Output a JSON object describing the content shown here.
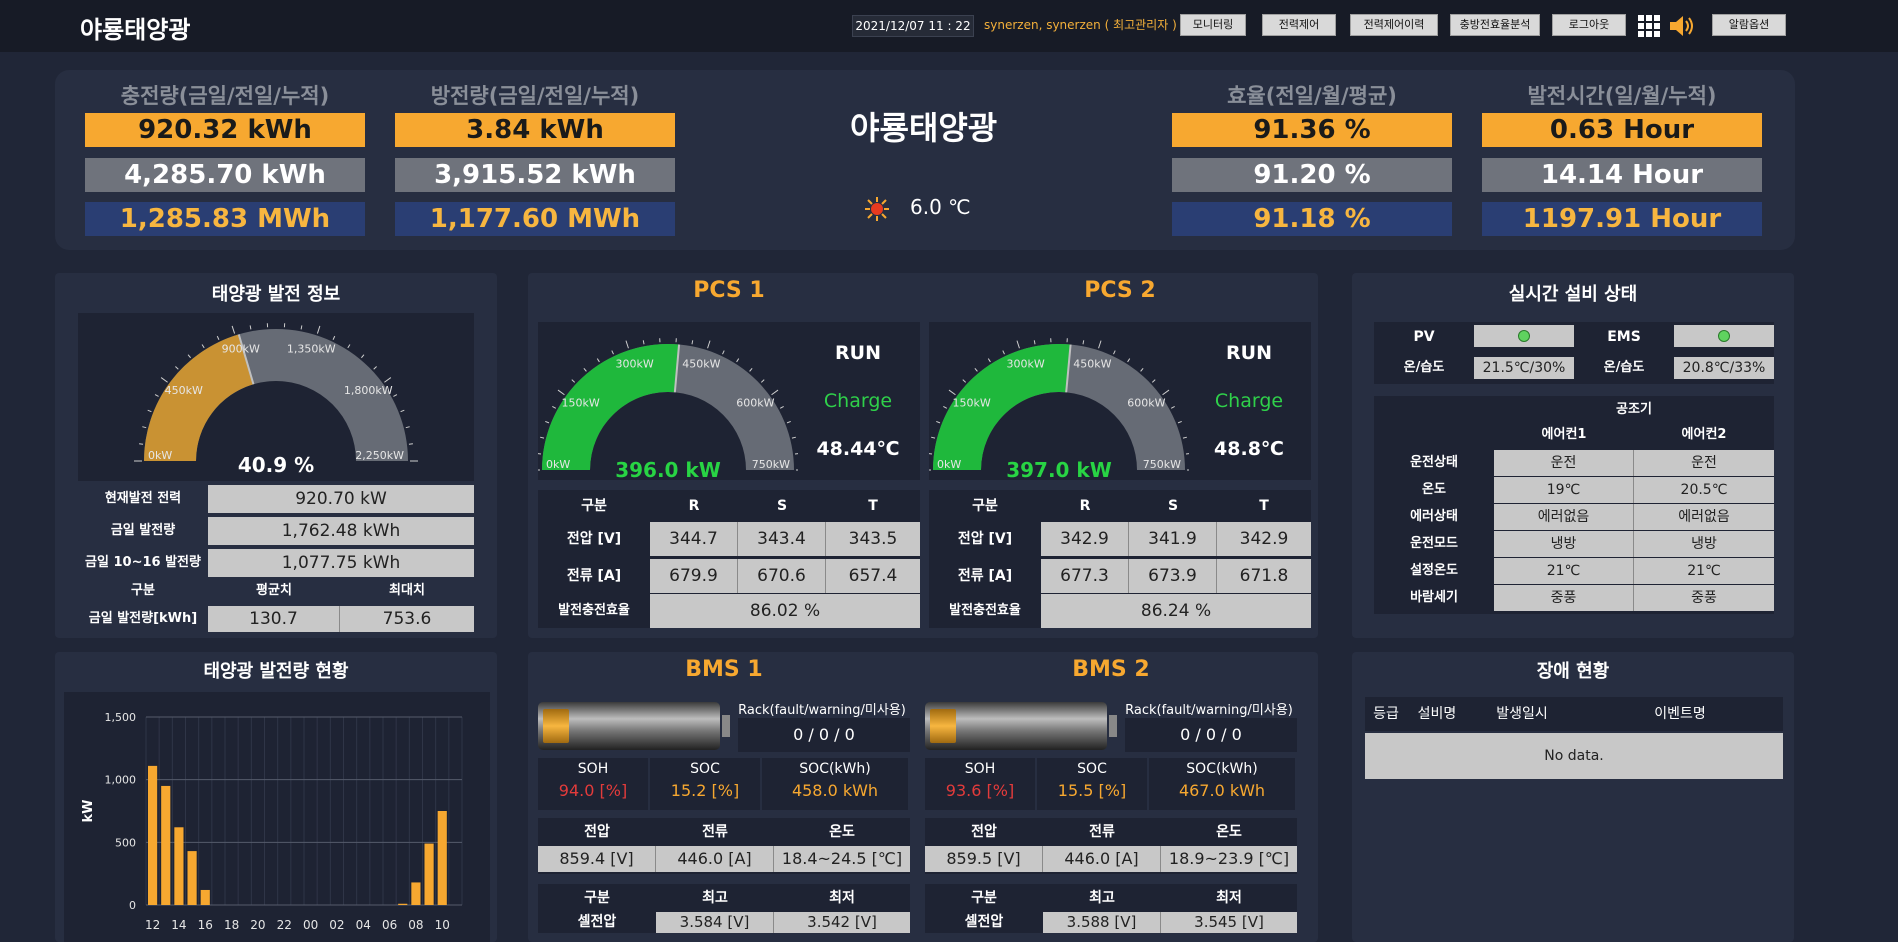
{
  "app": {
    "title": "야룡태양광",
    "datetime": "2021/12/07 11 : 22",
    "user": "synerzen, synerzen ( 최고관리자 )"
  },
  "nav": [
    "모니터링",
    "전력제어",
    "전력제어이력",
    "충방전효율분석",
    "로그아웃",
    "알람옵션"
  ],
  "summary": {
    "title": "야룡태양광",
    "temp": "6.0 ℃",
    "charge": {
      "label": "충전량(금일/전일/누적)",
      "v1": "920.32 kWh",
      "v2": "4,285.70 kWh",
      "v3": "1,285.83 MWh"
    },
    "discharge": {
      "label": "방전량(금일/전일/누적)",
      "v1": "3.84 kWh",
      "v2": "3,915.52 kWh",
      "v3": "1,177.60 MWh"
    },
    "efficiency": {
      "label": "효율(전일/월/평균)",
      "v1": "91.36 %",
      "v2": "91.20 %",
      "v3": "91.18 %"
    },
    "gentime": {
      "label": "발전시간(일/월/누적)",
      "v1": "0.63 Hour",
      "v2": "14.14 Hour",
      "v3": "1197.91 Hour"
    }
  },
  "solar": {
    "title": "태양광 발전 정보",
    "gauge": {
      "percent": "40.9 %",
      "value": 40.9,
      "ticks": [
        "0kW",
        "450kW",
        "900kW",
        "1,350kW",
        "1,800kW",
        "2,250kW"
      ]
    },
    "rows": [
      {
        "label": "현재발전 전력",
        "value": "920.70  kW"
      },
      {
        "label": "금일 발전량",
        "value": "1,762.48  kWh"
      },
      {
        "label": "금일 10~16 발전량",
        "value": "1,077.75  kWh"
      }
    ],
    "table": {
      "h0": "구분",
      "h1": "평균치",
      "h2": "최대치",
      "r0": "금일 발전량[kWh]",
      "r1": "130.7",
      "r2": "753.6"
    }
  },
  "pcs": [
    {
      "title": "PCS 1",
      "gauge_value": "396.0 kW",
      "value": 396.0,
      "ticks": [
        "0kW",
        "150kW",
        "300kW",
        "450kW",
        "600kW",
        "750kW"
      ],
      "status": "RUN",
      "mode": "Charge",
      "temp": "48.44℃",
      "heads": [
        "구분",
        "R",
        "S",
        "T"
      ],
      "volt_label": "전압 [V]",
      "volt": [
        "344.7",
        "343.4",
        "343.5"
      ],
      "curr_label": "전류 [A]",
      "curr": [
        "679.9",
        "670.6",
        "657.4"
      ],
      "eff_label": "발전충전효율",
      "eff": "86.02 %"
    },
    {
      "title": "PCS 2",
      "gauge_value": "397.0 kW",
      "value": 397.0,
      "ticks": [
        "0kW",
        "150kW",
        "300kW",
        "450kW",
        "600kW",
        "750kW"
      ],
      "status": "RUN",
      "mode": "Charge",
      "temp": "48.8℃",
      "heads": [
        "구분",
        "R",
        "S",
        "T"
      ],
      "volt_label": "전압 [V]",
      "volt": [
        "342.9",
        "341.9",
        "342.9"
      ],
      "curr_label": "전류 [A]",
      "curr": [
        "677.3",
        "673.9",
        "671.8"
      ],
      "eff_label": "발전충전효율",
      "eff": "86.24 %"
    }
  ],
  "realtime": {
    "title": "실시간 설비 상태",
    "pv_label": "PV",
    "ems_label": "EMS",
    "hum_label": "온/습도",
    "pv_hum": "21.5℃/30%",
    "ems_hum": "20.8℃/33%",
    "ac_title": "공조기",
    "ac1": "에어컨1",
    "ac2": "에어컨2",
    "rows": [
      {
        "label": "운전상태",
        "a": "운전",
        "b": "운전"
      },
      {
        "label": "온도",
        "a": "19℃",
        "b": "20.5℃"
      },
      {
        "label": "에러상태",
        "a": "에러없음",
        "b": "에러없음"
      },
      {
        "label": "운전모드",
        "a": "냉방",
        "b": "냉방"
      },
      {
        "label": "설정온도",
        "a": "21℃",
        "b": "21℃"
      },
      {
        "label": "바람세기",
        "a": "중풍",
        "b": "중풍"
      }
    ],
    "colors": {
      "led": "#5fd35f"
    }
  },
  "chart_panel": {
    "title": "태양광 발전량 현황"
  },
  "chart_data": {
    "type": "bar",
    "ylabel": "kW",
    "ylim": [
      0,
      1500
    ],
    "yticks": [
      "0",
      "500",
      "1,000",
      "1,500"
    ],
    "categories": [
      "12",
      "13",
      "14",
      "15",
      "16",
      "17",
      "18",
      "19",
      "20",
      "21",
      "22",
      "23",
      "00",
      "01",
      "02",
      "03",
      "04",
      "05",
      "06",
      "07",
      "08",
      "09",
      "10",
      "11"
    ],
    "xtick_labels": [
      "12",
      "14",
      "16",
      "18",
      "20",
      "22",
      "00",
      "02",
      "04",
      "06",
      "08",
      "10"
    ],
    "values": [
      1110,
      950,
      620,
      430,
      120,
      0,
      0,
      0,
      0,
      0,
      0,
      0,
      0,
      0,
      0,
      0,
      0,
      0,
      0,
      10,
      180,
      490,
      750,
      0
    ],
    "color": "#f7a830"
  },
  "bms": [
    {
      "title": "BMS 1",
      "rack_label": "Rack(fault/warning/미사용)",
      "rack": "0 / 0 / 0",
      "soh_label": "SOH",
      "soh": "94.0 [%]",
      "soc_label": "SOC",
      "soc": "15.2 [%]",
      "sock_label": "SOC(kWh)",
      "sock": "458.0 kWh",
      "soc_level": 15.2,
      "h1": "전압",
      "h2": "전류",
      "h3": "온도",
      "v1": "859.4 [V]",
      "v2": "446.0 [A]",
      "v3": "18.4~24.5 [℃]",
      "g0": "구분",
      "g1": "최고",
      "g2": "최저",
      "c0": "셀전압",
      "c1": "3.584 [V]",
      "c2": "3.542 [V]"
    },
    {
      "title": "BMS 2",
      "rack_label": "Rack(fault/warning/미사용)",
      "rack": "0 / 0 / 0",
      "soh_label": "SOH",
      "soh": "93.6 [%]",
      "soc_label": "SOC",
      "soc": "15.5 [%]",
      "sock_label": "SOC(kWh)",
      "sock": "467.0 kWh",
      "soc_level": 15.5,
      "h1": "전압",
      "h2": "전류",
      "h3": "온도",
      "v1": "859.5 [V]",
      "v2": "446.0 [A]",
      "v3": "18.9~23.9 [℃]",
      "g0": "구분",
      "g1": "최고",
      "g2": "최저",
      "c0": "셀전압",
      "c1": "3.588 [V]",
      "c2": "3.545 [V]"
    }
  ],
  "fault": {
    "title": "장애 현황",
    "heads": [
      "등급",
      "설비명",
      "발생일시",
      "이벤트명"
    ],
    "empty": "No data."
  }
}
